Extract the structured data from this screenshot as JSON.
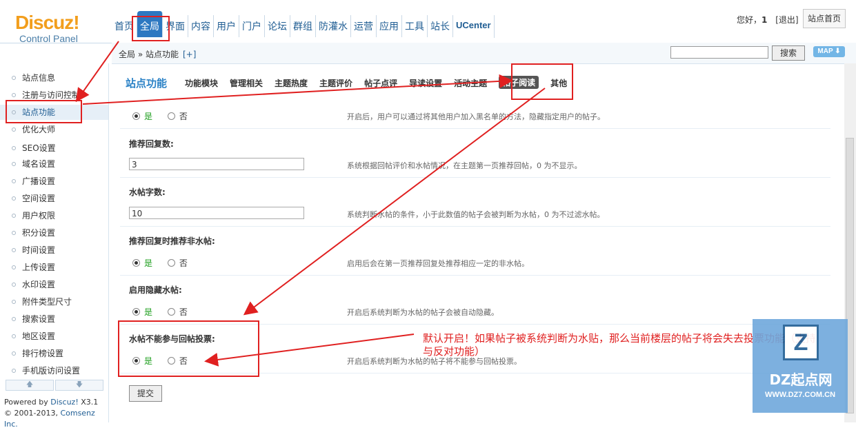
{
  "header": {
    "brand": "Discuz!",
    "subtitle": "Control Panel",
    "nav": [
      "首页",
      "全局",
      "界面",
      "内容",
      "用户",
      "门户",
      "论坛",
      "群组",
      "防灌水",
      "运营",
      "应用",
      "工具",
      "站长",
      "UCenter"
    ],
    "active_nav_index": 1,
    "greeting": "您好，",
    "username": "1",
    "logout": "[退出]",
    "home_button": "站点首页"
  },
  "breadcrumb": {
    "path": "全局 » 站点功能",
    "add": "[+]",
    "search_button": "搜索",
    "map_button": "MAP ⬇"
  },
  "sidebar": {
    "items": [
      "站点信息",
      "注册与访问控制",
      "站点功能",
      "优化大师",
      "SEO设置",
      "域名设置",
      "广播设置",
      "空间设置",
      "用户权限",
      "积分设置",
      "时间设置",
      "上传设置",
      "水印设置",
      "附件类型尺寸",
      "搜索设置",
      "地区设置",
      "排行榜设置",
      "手机版访问设置"
    ],
    "active_index": 2,
    "up_arrow": "🡅",
    "down_arrow": "🡇",
    "powered_prefix": "Powered by ",
    "powered_product": "Discuz!",
    "powered_version": " X3.1",
    "copyright_prefix": "© 2001-2013, ",
    "copyright_company": "Comsenz Inc."
  },
  "main": {
    "section_title": "站点功能",
    "tabs": [
      "功能模块",
      "管理相关",
      "主题热度",
      "主题评价",
      "帖子点评",
      "导读设置",
      "活动主题",
      "帖子阅读",
      "其他"
    ],
    "active_tab_index": 7,
    "yes_label": "是",
    "no_label": "否",
    "top_row_tip": "开启后，用户可以通过将其他用户加入黑名单的方法，隐藏指定用户的帖子。",
    "settings": [
      {
        "title": "推荐回复数:",
        "value": "3",
        "tip": "系统根据回帖评价和水帖情况，在主题第一页推荐回帖，0 为不显示。"
      },
      {
        "title": "水帖字数:",
        "value": "10",
        "tip": "系统判断水帖的条件，小于此数值的帖子会被判断为水帖，0 为不过滤水帖。"
      },
      {
        "title": "推荐回复时推荐非水帖:",
        "tip": "启用后会在第一页推荐回复处推荐相应一定的非水帖。"
      },
      {
        "title": "启用隐藏水帖:",
        "tip": "开启后系统判断为水帖的帖子会被自动隐藏。"
      },
      {
        "title": "水帖不能参与回帖投票:",
        "tip": "开启后系统判断为水帖的帖子将不能参与回帖投票。"
      }
    ],
    "submit": "提交"
  },
  "annotation": {
    "note": "默认开启！如果帖子被系统判断为水贴，那么当前楼层的帖子将会失去投票功能（支持与反对功能）",
    "color": "#e02020"
  },
  "watermark": {
    "logo_text": "Z",
    "name": "DZ起点网",
    "url": "WWW.DZ7.COM.CN"
  }
}
